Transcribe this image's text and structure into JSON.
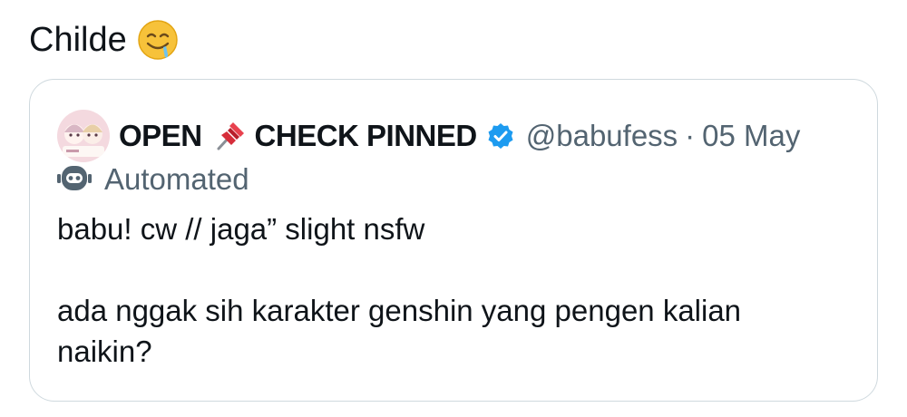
{
  "post": {
    "text": "Childe",
    "emoji": "drooling-face"
  },
  "quote": {
    "display_name_part1": "OPEN",
    "pin_emoji": "pushpin-icon",
    "display_name_part2": "CHECK PINNED",
    "verified_icon": "verified-badge-icon",
    "handle": "@babufess",
    "separator": "·",
    "date": "05 May",
    "automated_label": "Automated",
    "body_line1": "babu! cw // jaga” slight nsfw",
    "body_line2": "ada nggak sih karakter genshin yang pengen kalian",
    "body_line3": "naikin?"
  },
  "colors": {
    "text": "#0f1419",
    "secondary_text": "#536471",
    "border": "#cfd9de",
    "verified": "#1d9bf0"
  }
}
